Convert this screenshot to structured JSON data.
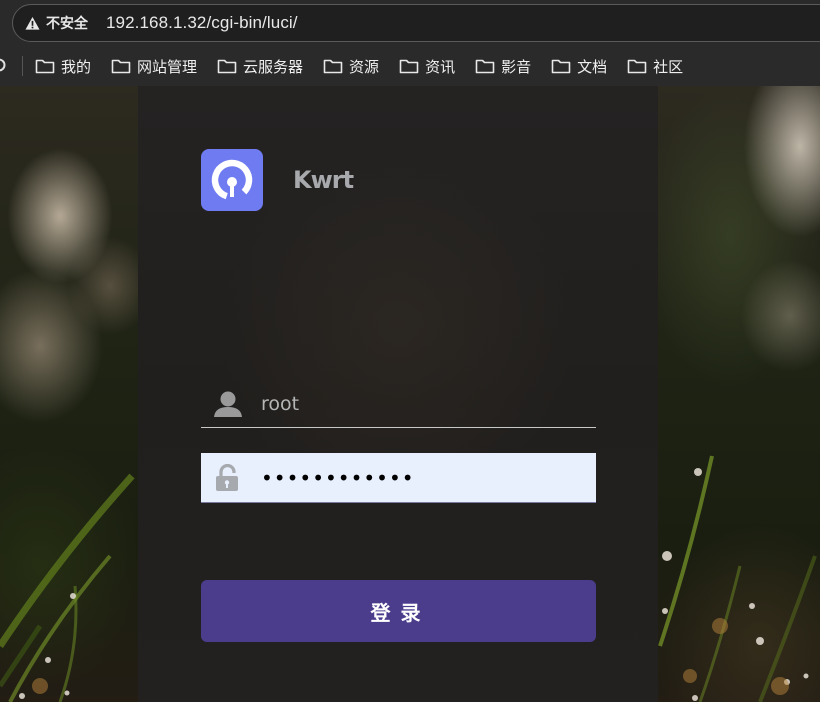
{
  "browser": {
    "security_label": "不安全",
    "url": "192.168.1.32/cgi-bin/luci/",
    "bookmarks": [
      {
        "label": "我的"
      },
      {
        "label": "网站管理"
      },
      {
        "label": "云服务器"
      },
      {
        "label": "资源"
      },
      {
        "label": "资讯"
      },
      {
        "label": "影音"
      },
      {
        "label": "文档"
      },
      {
        "label": "社区"
      }
    ]
  },
  "login": {
    "brand_name": "Kwrt",
    "username_value": "root",
    "password_value": "••••••••••••",
    "submit_label": "登录"
  },
  "colors": {
    "brand_logo": "#6f7bf0",
    "submit_button": "#4b3c8c",
    "password_autofill": "#e8f0fe",
    "panel": "#222120"
  },
  "icons": {
    "security": "warning-triangle-icon",
    "bookmark": "folder-icon",
    "username": "user-icon",
    "password": "unlock-icon",
    "brand": "kwrt-logo-icon"
  }
}
